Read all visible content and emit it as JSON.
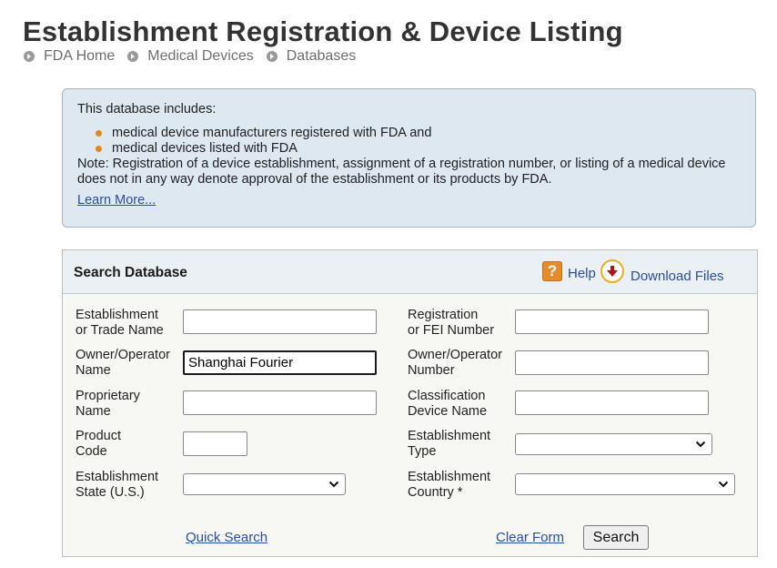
{
  "page": {
    "title": "Establishment Registration & Device Listing"
  },
  "breadcrumb": {
    "items": [
      "FDA Home",
      "Medical Devices",
      "Databases"
    ]
  },
  "info": {
    "intro": "This database includes:",
    "bullets": [
      "medical device manufacturers registered with FDA and",
      "medical devices listed with FDA"
    ],
    "note": "Note: Registration of a device establishment, assignment of a registration number, or listing of a medical device does not in any way denote approval of the establishment or its products by FDA.",
    "learn_more": "Learn More..."
  },
  "search": {
    "title": "Search Database",
    "help_label": "Help",
    "download_label": "Download Files",
    "fields": {
      "establishment_name": {
        "label1": "Establishment",
        "label2": "or Trade Name",
        "value": ""
      },
      "registration_number": {
        "label1": "Registration",
        "label2": "or FEI Number",
        "value": ""
      },
      "owner_operator_name": {
        "label1": "Owner/Operator",
        "label2": "Name",
        "value": "Shanghai Fourier"
      },
      "owner_operator_number": {
        "label1": "Owner/Operator",
        "label2": "Number",
        "value": ""
      },
      "proprietary_name": {
        "label1": "Proprietary",
        "label2": "Name",
        "value": ""
      },
      "classification_name": {
        "label1": "Classification",
        "label2": "Device Name",
        "value": ""
      },
      "product_code": {
        "label1": "Product",
        "label2": "Code",
        "value": ""
      },
      "establishment_type": {
        "label1": "Establishment",
        "label2": "Type",
        "value": ""
      },
      "establishment_state": {
        "label1": "Establishment",
        "label2": "State (U.S.)",
        "value": ""
      },
      "establishment_country": {
        "label1": "Establishment",
        "label2": "Country *",
        "value": ""
      }
    },
    "quick_search": "Quick Search",
    "clear_form": "Clear Form",
    "search_button": "Search"
  },
  "colors": {
    "accent_link": "#2a4ca0",
    "info_bg": "#dde8f1",
    "bullet": "#e08a1e",
    "help_icon": "#e58c2c"
  },
  "icons": [
    "breadcrumb-arrow-icon",
    "help-icon",
    "download-icon",
    "chevron-down-icon"
  ]
}
